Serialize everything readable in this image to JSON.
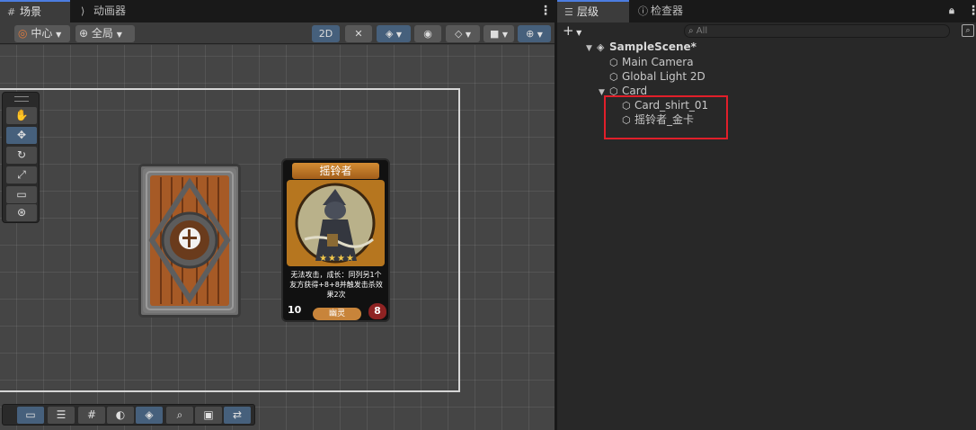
{
  "scene_panel": {
    "tabs": [
      {
        "label": "场景",
        "icon": "grid-icon"
      },
      {
        "label": "动画器",
        "icon": "animator-icon"
      }
    ],
    "pivot_label": "中心",
    "space_label": "全局",
    "mode_2d_label": "2D",
    "cards": {
      "front": {
        "title": "摇铃者",
        "description": "无法攻击，成长：同列另1个友方获得+8+8并触发击杀效果2次",
        "attack": "10",
        "type": "幽灵",
        "health": "8",
        "stars": 4
      }
    }
  },
  "hierarchy_panel": {
    "tabs": [
      {
        "label": "层级",
        "icon": "list-icon"
      },
      {
        "label": "检查器",
        "icon": "info-icon"
      }
    ],
    "add_label": "+",
    "search_placeholder": "All",
    "tree": {
      "scene_name": "SampleScene*",
      "items": [
        {
          "label": "Main Camera"
        },
        {
          "label": "Global Light 2D"
        },
        {
          "label": "Card"
        },
        {
          "label": "Card_shirt_01"
        },
        {
          "label": "摇铃者_金卡"
        }
      ]
    }
  },
  "colors": {
    "selection_accent": "#46607c",
    "highlight_box": "#e11f2a",
    "card_frame": "#b6761f"
  }
}
